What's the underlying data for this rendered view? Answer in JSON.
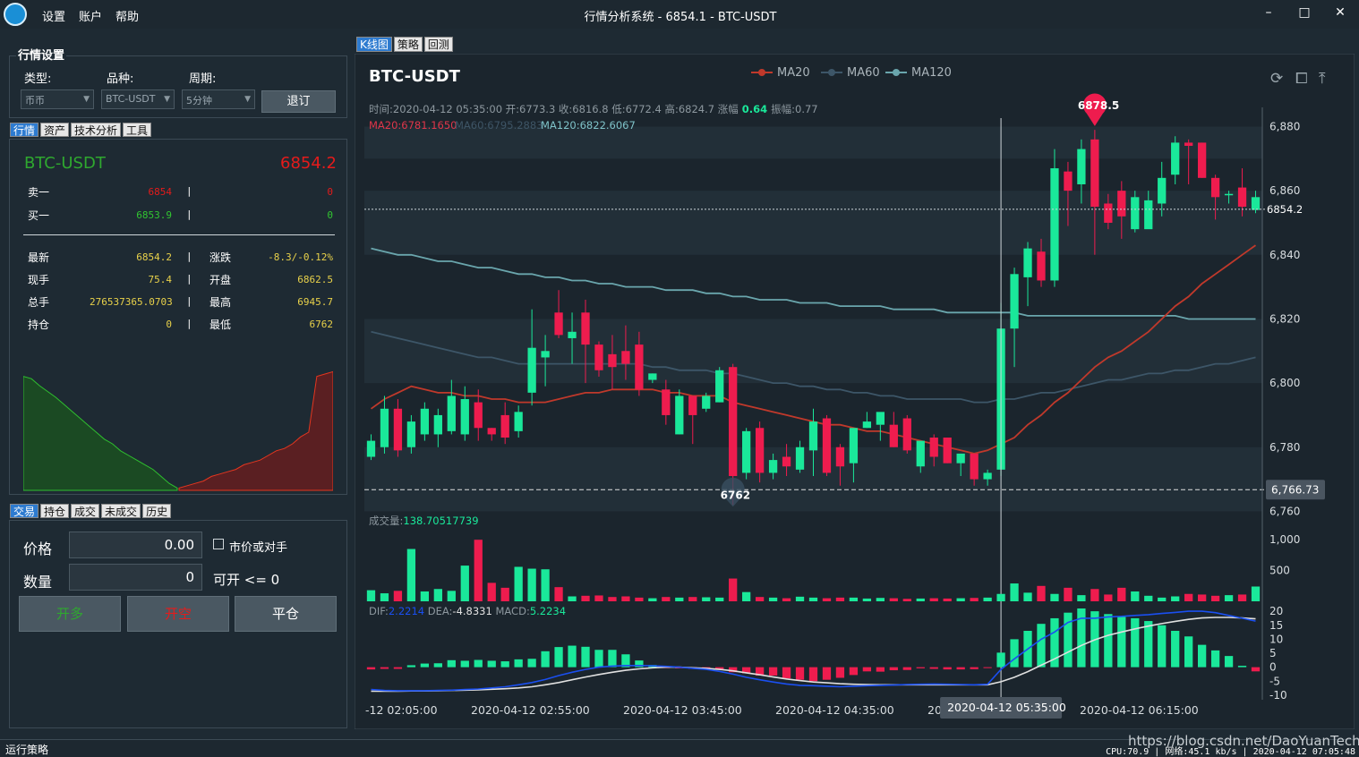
{
  "app": {
    "title": "行情分析系统 - 6854.1 - BTC-USDT",
    "menu": [
      "设置",
      "账户",
      "帮助"
    ],
    "window_buttons": [
      "–",
      "□",
      "✕"
    ]
  },
  "settings": {
    "title": "行情设置",
    "type_label": "类型:",
    "symbol_label": "品种:",
    "period_label": "周期:",
    "type_value": "币币",
    "symbol_value": "BTC-USDT",
    "period_value": "5分钟",
    "exit_label": "退订"
  },
  "left_tabs": [
    "行情",
    "资产",
    "技术分析",
    "工具"
  ],
  "quote": {
    "symbol": "BTC-USDT",
    "price": "6854.2",
    "ask_label": "卖一",
    "ask_price": "6854",
    "ask_vol": "0",
    "bid_label": "买一",
    "bid_price": "6853.9",
    "bid_vol": "0",
    "rows": [
      {
        "l1": "最新",
        "v1": "6854.2",
        "l2": "涨跌",
        "v2": "-8.3/-0.12%"
      },
      {
        "l1": "现手",
        "v1": "75.4",
        "l2": "开盘",
        "v2": "6862.5"
      },
      {
        "l1": "总手",
        "v1": "276537365.0703",
        "l2": "最高",
        "v2": "6945.7"
      },
      {
        "l1": "持仓",
        "v1": "0",
        "l2": "最低",
        "v2": "6762"
      }
    ]
  },
  "depth": {
    "bids": [
      0.98,
      0.96,
      0.9,
      0.85,
      0.8,
      0.74,
      0.68,
      0.62,
      0.56,
      0.5,
      0.44,
      0.4,
      0.34,
      0.3,
      0.26,
      0.22,
      0.18,
      0.12,
      0.06,
      0.02
    ],
    "asks": [
      0.02,
      0.04,
      0.06,
      0.08,
      0.12,
      0.14,
      0.16,
      0.18,
      0.22,
      0.24,
      0.26,
      0.3,
      0.34,
      0.36,
      0.4,
      0.46,
      0.5,
      0.98,
      1.0,
      1.02
    ]
  },
  "trade_tabs": [
    "交易",
    "持仓",
    "成交",
    "未成交",
    "历史"
  ],
  "trade": {
    "price_label": "价格",
    "price_value": "0.00",
    "market_label": "市价或对手",
    "qty_label": "数量",
    "qty_value": "0",
    "avail_label": "可开 <=  0",
    "buy_label": "开多",
    "sell_label": "开空",
    "close_label": "平仓"
  },
  "chart_tabs": [
    "K线图",
    "策略",
    "回测"
  ],
  "chart_data": {
    "type": "candlestick",
    "title": "BTC-USDT",
    "legend": [
      "MA20",
      "MA60",
      "MA120"
    ],
    "info_line1": "时间:2020-04-12 05:35:00 开:6773.3 收:6816.8 低:6772.4 高:6824.7 涨幅",
    "info_line1_val": "0.64",
    "info_line1_tail": "振幅:0.77",
    "ma20_label": "MA20:6781.1650",
    "ma60_label": "MA60:6795.2883",
    "ma120_label": "MA120:6822.6067",
    "ylim": [
      6759,
      6886
    ],
    "yticks": [
      "6,880",
      "6,860",
      "6,840",
      "6,820",
      "6,800",
      "6,780",
      "6,760"
    ],
    "max_marker": "6878.5",
    "max_value": 6878.5,
    "min_marker": "6762",
    "min_value": 6762,
    "current": "6854.2",
    "current_value": 6854.2,
    "cursor": "6,766.73",
    "cursor_value": 6766.73,
    "candles": [
      [
        6777,
        6782,
        6776,
        6784
      ],
      [
        6780,
        6792,
        6778,
        6796
      ],
      [
        6792,
        6779,
        6777,
        6795
      ],
      [
        6780,
        6788,
        6778,
        6790
      ],
      [
        6784,
        6792,
        6782,
        6794
      ],
      [
        6784,
        6790,
        6780,
        6792
      ],
      [
        6785,
        6796,
        6784,
        6801
      ],
      [
        6784,
        6795,
        6782,
        6799
      ],
      [
        6794,
        6786,
        6782,
        6798
      ],
      [
        6786,
        6784,
        6782,
        6786
      ],
      [
        6790,
        6783,
        6781,
        6794
      ],
      [
        6785,
        6791,
        6783,
        6793
      ],
      [
        6797,
        6811,
        6793,
        6823
      ],
      [
        6808,
        6810,
        6799,
        6815
      ],
      [
        6822,
        6815,
        6814,
        6829
      ],
      [
        6814,
        6816,
        6806,
        6822
      ],
      [
        6822,
        6812,
        6800,
        6826
      ],
      [
        6812,
        6804,
        6802,
        6813
      ],
      [
        6809,
        6805,
        6798,
        6815
      ],
      [
        6810,
        6806,
        6801,
        6818
      ],
      [
        6812,
        6798,
        6796,
        6816
      ],
      [
        6801,
        6803,
        6800,
        6803
      ],
      [
        6798,
        6790,
        6787,
        6801
      ],
      [
        6784,
        6796,
        6784,
        6798
      ],
      [
        6796,
        6790,
        6781,
        6796
      ],
      [
        6792,
        6796,
        6791,
        6797
      ],
      [
        6794,
        6804,
        6794,
        6805
      ],
      [
        6805,
        6771,
        6762,
        6806
      ],
      [
        6772,
        6785,
        6770,
        6786
      ],
      [
        6786,
        6772,
        6769,
        6788
      ],
      [
        6772,
        6776,
        6770,
        6778
      ],
      [
        6777,
        6774,
        6771,
        6781
      ],
      [
        6773,
        6780,
        6772,
        6782
      ],
      [
        6779,
        6788,
        6771,
        6792
      ],
      [
        6789,
        6772,
        6771,
        6790
      ],
      [
        6780,
        6774,
        6768,
        6781
      ],
      [
        6775,
        6786,
        6769,
        6786
      ],
      [
        6786,
        6788,
        6786,
        6791
      ],
      [
        6787,
        6791,
        6782,
        6787
      ],
      [
        6787,
        6780,
        6780,
        6791
      ],
      [
        6789,
        6779,
        6778,
        6790
      ],
      [
        6774,
        6782,
        6772,
        6782
      ],
      [
        6783,
        6777,
        6774,
        6784
      ],
      [
        6783,
        6775,
        6775,
        6783
      ],
      [
        6775,
        6778,
        6771,
        6778
      ],
      [
        6778,
        6770,
        6768,
        6778
      ],
      [
        6770,
        6772,
        6768,
        6773
      ],
      [
        6773,
        6817,
        6771,
        6825
      ],
      [
        6817,
        6834,
        6805,
        6836
      ],
      [
        6833,
        6842,
        6824,
        6844
      ],
      [
        6841,
        6832,
        6830,
        6845
      ],
      [
        6832,
        6867,
        6830,
        6873
      ],
      [
        6866,
        6860,
        6849,
        6869
      ],
      [
        6862,
        6873,
        6856,
        6876
      ],
      [
        6876,
        6855,
        6840,
        6879
      ],
      [
        6856,
        6850,
        6848,
        6859
      ],
      [
        6860,
        6852,
        6845,
        6863
      ],
      [
        6848,
        6858,
        6847,
        6860
      ],
      [
        6848,
        6857,
        6850,
        6860
      ],
      [
        6856,
        6864,
        6852,
        6869
      ],
      [
        6865,
        6875,
        6862,
        6877
      ],
      [
        6875,
        6874,
        6862,
        6876
      ],
      [
        6875,
        6864,
        6864,
        6875
      ],
      [
        6864,
        6858,
        6851,
        6865
      ],
      [
        6859,
        6859,
        6856,
        6860
      ],
      [
        6861,
        6855,
        6852,
        6867
      ],
      [
        6854,
        6858,
        6853,
        6860
      ]
    ],
    "ma20": [
      6792,
      6795,
      6797,
      6799,
      6798,
      6797,
      6797,
      6796,
      6796,
      6795,
      6795,
      6794,
      6794,
      6794,
      6795,
      6796,
      6797,
      6797,
      6798,
      6798,
      6798,
      6798,
      6797,
      6797,
      6796,
      6796,
      6796,
      6794,
      6793,
      6792,
      6791,
      6790,
      6789,
      6788,
      6787,
      6787,
      6786,
      6785,
      6785,
      6784,
      6783,
      6782,
      6781,
      6780,
      6779,
      6778,
      6779,
      6781,
      6783,
      6787,
      6790,
      6794,
      6797,
      6801,
      6805,
      6808,
      6810,
      6813,
      6816,
      6820,
      6824,
      6827,
      6831,
      6834,
      6837,
      6840,
      6843
    ],
    "ma60": [
      6816,
      6815,
      6814,
      6813,
      6812,
      6811,
      6810,
      6809,
      6808,
      6808,
      6807,
      6806,
      6806,
      6806,
      6806,
      6806,
      6806,
      6806,
      6806,
      6806,
      6806,
      6805,
      6805,
      6804,
      6804,
      6804,
      6803,
      6803,
      6802,
      6801,
      6800,
      6800,
      6799,
      6799,
      6798,
      6798,
      6797,
      6797,
      6796,
      6796,
      6795,
      6795,
      6795,
      6795,
      6795,
      6794,
      6794,
      6795,
      6795,
      6796,
      6797,
      6797,
      6798,
      6799,
      6800,
      6801,
      6801,
      6802,
      6803,
      6803,
      6804,
      6804,
      6805,
      6806,
      6806,
      6807,
      6808
    ],
    "ma120": [
      6842,
      6841,
      6840,
      6840,
      6839,
      6838,
      6838,
      6837,
      6836,
      6836,
      6835,
      6834,
      6834,
      6833,
      6833,
      6832,
      6832,
      6831,
      6831,
      6830,
      6830,
      6830,
      6829,
      6829,
      6829,
      6828,
      6828,
      6827,
      6827,
      6826,
      6826,
      6826,
      6825,
      6825,
      6825,
      6824,
      6824,
      6824,
      6824,
      6823,
      6823,
      6823,
      6823,
      6822,
      6822,
      6822,
      6822,
      6822,
      6822,
      6821,
      6821,
      6821,
      6821,
      6821,
      6821,
      6821,
      6821,
      6821,
      6821,
      6821,
      6821,
      6820,
      6820,
      6820,
      6820,
      6820,
      6820
    ],
    "volume_label": "成交量:",
    "volume_value": "138.70517739",
    "vol_ylim": [
      0,
      1250
    ],
    "vol_yticks": [
      "1,000",
      "500"
    ],
    "volume": [
      180,
      130,
      170,
      850,
      160,
      200,
      170,
      580,
      1000,
      300,
      220,
      560,
      530,
      520,
      230,
      80,
      90,
      95,
      70,
      80,
      60,
      50,
      70,
      60,
      70,
      65,
      60,
      370,
      150,
      70,
      60,
      50,
      75,
      60,
      50,
      60,
      60,
      45,
      55,
      50,
      40,
      45,
      50,
      45,
      50,
      55,
      60,
      120,
      290,
      140,
      250,
      120,
      220,
      100,
      200,
      110,
      220,
      160,
      90,
      60,
      80,
      120,
      110,
      90,
      100,
      110,
      240
    ],
    "macd_label_dif": "DIF:",
    "macd_dif": "2.2214",
    "macd_label_dea": "DEA:",
    "macd_dea": "-4.8331",
    "macd_label_macd": "MACD:",
    "macd_val": "5.2234",
    "macd_ylim": [
      -11,
      21
    ],
    "macd_yticks": [
      "20",
      "15",
      "10",
      "5",
      "0",
      "-5",
      "-10"
    ],
    "macd_hist": [
      -0.8,
      -0.6,
      -0.6,
      0.7,
      1.3,
      1.4,
      2.5,
      2.3,
      2.6,
      2.3,
      2.1,
      2.8,
      3,
      5.7,
      7.2,
      7.7,
      7.3,
      6.2,
      6.2,
      4.6,
      2.4,
      0.8,
      -0.3,
      -0.4,
      -0.6,
      -0.8,
      -0.9,
      -1.8,
      -2.2,
      -3,
      -3,
      -4,
      -4.5,
      -5,
      -4.5,
      -3.8,
      -2.8,
      -1.5,
      -1.6,
      -1.1,
      -1,
      -0.4,
      -0.6,
      -0.8,
      -0.8,
      -0.7,
      -0.3,
      5.2,
      10,
      13,
      15.5,
      17.5,
      19.5,
      21,
      20,
      19,
      18,
      17.5,
      16.5,
      15,
      13,
      11,
      8,
      6,
      4,
      0.5,
      -1.5
    ],
    "macd_dif_line": [
      -8,
      -8.3,
      -8.4,
      -8.4,
      -8.4,
      -8.3,
      -8.2,
      -8,
      -7.8,
      -7.4,
      -7,
      -6.3,
      -5.5,
      -4.4,
      -3,
      -1.8,
      -0.8,
      0,
      0.4,
      0.6,
      0.6,
      0.5,
      0.3,
      0,
      -0.4,
      -0.8,
      -1.5,
      -2.5,
      -3.6,
      -4.5,
      -5.3,
      -6,
      -6.5,
      -6.6,
      -6.8,
      -7,
      -6.8,
      -6.6,
      -6.5,
      -6.4,
      -6.2,
      -6.1,
      -6,
      -6.1,
      -6.2,
      -6.3,
      -6.1,
      -0.8,
      3,
      6.5,
      10,
      12.6,
      16,
      17.5,
      17.5,
      18,
      18.2,
      18.5,
      18.8,
      19.2,
      19.6,
      20,
      20,
      19.5,
      18.5,
      17.5,
      16.5
    ],
    "macd_dea_line": [
      -8.6,
      -8.6,
      -8.6,
      -8.5,
      -8.5,
      -8.4,
      -8.3,
      -8.2,
      -8.1,
      -7.9,
      -7.7,
      -7.4,
      -7,
      -6.3,
      -5.5,
      -4.5,
      -3.5,
      -2.6,
      -1.8,
      -1.1,
      -0.6,
      -0.2,
      0,
      0,
      -0.2,
      -0.4,
      -0.8,
      -1.3,
      -2,
      -2.7,
      -3.5,
      -4.2,
      -4.8,
      -5.3,
      -5.6,
      -5.9,
      -6.1,
      -6.2,
      -6.3,
      -6.3,
      -6.3,
      -6.3,
      -6.3,
      -6.3,
      -6.3,
      -6.3,
      -6.3,
      -5.2,
      -3.6,
      -1.6,
      0.7,
      3,
      5.4,
      7.8,
      9.8,
      11.4,
      12.6,
      13.7,
      14.7,
      15.6,
      16.4,
      17.1,
      17.6,
      17.8,
      17.8,
      17.6,
      17.3
    ],
    "x_labels": [
      "-12 02:05:00",
      "2020-04-12 02:55:00",
      "2020-04-12 03:45:00",
      "2020-04-12 04:35:00",
      "2020",
      "2020-04-12 06:15:00"
    ],
    "cursor_time": "2020-04-12 05:35:00",
    "colors": {
      "up": "#1ae89a",
      "down": "#ee1c4e",
      "ma20": "#c0392b",
      "ma60": "#3d5668",
      "ma120": "#6aa6ad",
      "dif": "#1a4ff0",
      "dea": "#e0e0e0"
    }
  },
  "statusbar": {
    "left": "运行策略",
    "right": "CPU:70.9 | 网络:45.1 kb/s | 2020-04-12 07:05:48",
    "watermark": "https://blog.csdn.net/DaoYuanTech"
  }
}
